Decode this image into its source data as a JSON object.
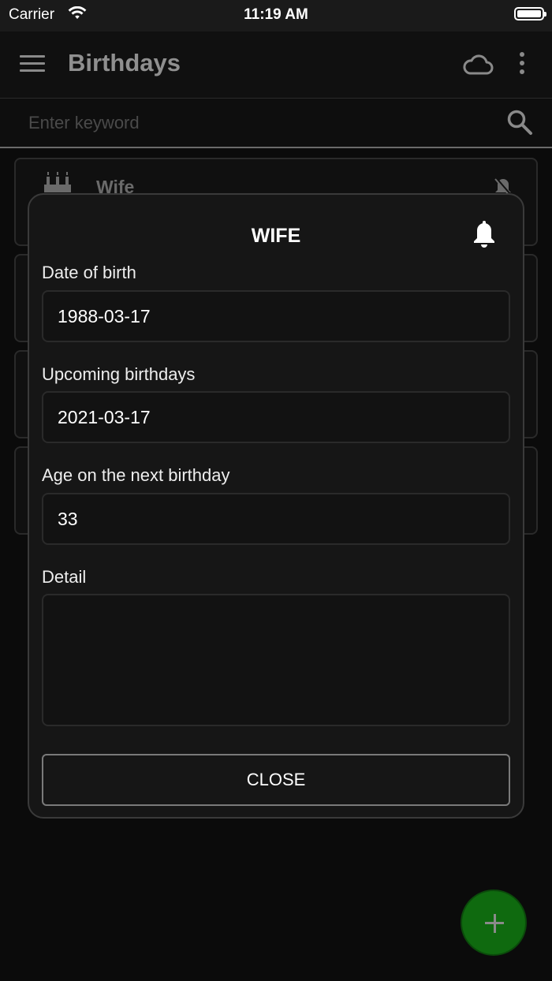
{
  "status_bar": {
    "carrier": "Carrier",
    "time": "11:19 AM"
  },
  "app_bar": {
    "title": "Birthdays",
    "icons": [
      "menu-icon",
      "cloud-icon",
      "more-vert-icon"
    ]
  },
  "search": {
    "placeholder": "Enter keyword",
    "value": "",
    "icon": "search-icon"
  },
  "list": {
    "items": [
      {
        "name": "Wife"
      },
      {
        "name": ""
      },
      {
        "name": ""
      },
      {
        "name": ""
      }
    ]
  },
  "dialog": {
    "title": "WIFE",
    "bell_icon": "bell-icon",
    "fields": [
      {
        "label": "Date of birth",
        "value": "1988-03-17"
      },
      {
        "label": "Upcoming birthdays",
        "value": "2021-03-17"
      },
      {
        "label": "Age on the next birthday",
        "value": "33"
      }
    ],
    "detail": {
      "label": "Detail",
      "value": ""
    },
    "close_label": "CLOSE"
  },
  "fab": {
    "icon": "plus-icon"
  },
  "colors": {
    "background": "#0b0b0b",
    "dialog": "#161616",
    "fab": "#0f6a0f"
  }
}
